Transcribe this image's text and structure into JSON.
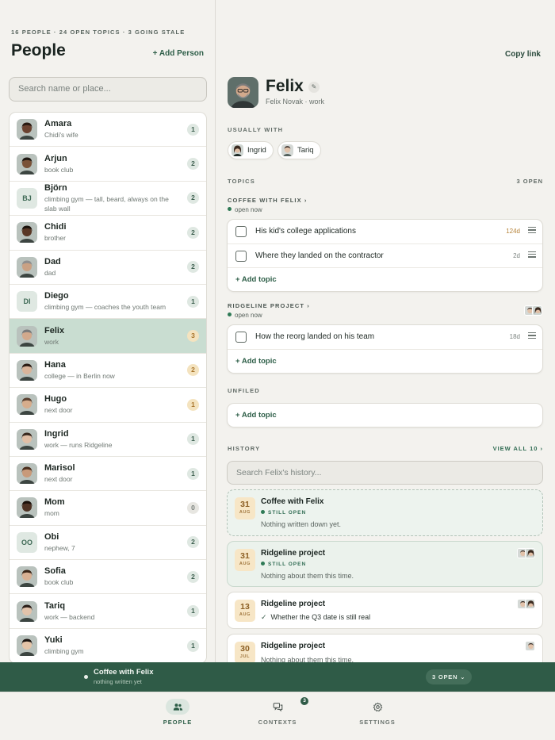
{
  "left": {
    "stats": "16 PEOPLE · 24 OPEN TOPICS · 3 GOING STALE",
    "title": "People",
    "add_person": "+ Add Person",
    "search_placeholder": "Search name or place...",
    "people": [
      {
        "name": "Amara",
        "sub": "Chidi's wife",
        "count": "1",
        "avatar": "photo",
        "skin": "#6b4230",
        "hair": "#2a1a12"
      },
      {
        "name": "Arjun",
        "sub": "book club",
        "count": "2",
        "avatar": "photo",
        "skin": "#7a5238",
        "hair": "#1e1610"
      },
      {
        "name": "Björn",
        "sub": "climbing gym — tall, beard, always on the slab wall",
        "count": "2",
        "avatar": "initials",
        "initials": "BJ"
      },
      {
        "name": "Chidi",
        "sub": "brother",
        "count": "2",
        "avatar": "photo",
        "skin": "#5a3826",
        "hair": "#1a120c"
      },
      {
        "name": "Dad",
        "sub": "dad",
        "count": "2",
        "avatar": "photo",
        "skin": "#c9a184",
        "hair": "#8f8f8f"
      },
      {
        "name": "Diego",
        "sub": "climbing gym — coaches the youth team",
        "count": "1",
        "avatar": "initials",
        "initials": "DI"
      },
      {
        "name": "Felix",
        "sub": "work",
        "count": "3",
        "avatar": "photo",
        "skin": "#d2a98c",
        "hair": "#7b7b7b",
        "selected": true,
        "warm": true
      },
      {
        "name": "Hana",
        "sub": "college — in Berlin now",
        "count": "2",
        "avatar": "photo",
        "skin": "#d9b49a",
        "hair": "#2b1c14",
        "warm": true
      },
      {
        "name": "Hugo",
        "sub": "next door",
        "count": "1",
        "avatar": "photo",
        "skin": "#d6ad8d",
        "hair": "#5b4030",
        "warm": true
      },
      {
        "name": "Ingrid",
        "sub": "work — runs Ridgeline",
        "count": "1",
        "avatar": "photo",
        "skin": "#e0bea5",
        "hair": "#3a2a20"
      },
      {
        "name": "Marisol",
        "sub": "next door",
        "count": "1",
        "avatar": "photo",
        "skin": "#c89a7a",
        "hair": "#4a2e1e"
      },
      {
        "name": "Mom",
        "sub": "mom",
        "count": "0",
        "avatar": "photo",
        "skin": "#4e3224",
        "hair": "#1a100a",
        "zero": true
      },
      {
        "name": "Obi",
        "sub": "nephew, 7",
        "count": "2",
        "avatar": "initials",
        "initials": "OO"
      },
      {
        "name": "Sofia",
        "sub": "book club",
        "count": "2",
        "avatar": "photo",
        "skin": "#d8b093",
        "hair": "#3b2618"
      },
      {
        "name": "Tariq",
        "sub": "work — backend",
        "count": "1",
        "avatar": "photo",
        "skin": "#e2c3ab",
        "hair": "#2a1e18"
      },
      {
        "name": "Yuki",
        "sub": "climbing gym",
        "count": "1",
        "avatar": "photo",
        "skin": "#e4c4a8",
        "hair": "#1c1410"
      }
    ]
  },
  "right": {
    "copy_link": "Copy link",
    "name": "Felix",
    "subtitle": "Felix Novak · work",
    "usually_with_label": "USUALLY WITH",
    "usually_with": [
      {
        "name": "Ingrid"
      },
      {
        "name": "Tariq"
      }
    ],
    "topics_label": "TOPICS",
    "topics_count": "3 OPEN",
    "contexts": [
      {
        "title": "COFFEE WITH FELIX ›",
        "status": "open now",
        "topics": [
          {
            "text": "His kid's college applications",
            "age": "124d"
          },
          {
            "text": "Where they landed on the contractor",
            "age": "2d"
          }
        ],
        "add_label": "+ Add topic"
      },
      {
        "title": "RIDGELINE PROJECT ›",
        "status": "open now",
        "topics": [
          {
            "text": "How the reorg landed on his team",
            "age": "18d"
          }
        ],
        "add_label": "+ Add topic"
      }
    ],
    "unfiled_label": "UNFILED",
    "unfiled_add": "+ Add topic",
    "history_label": "HISTORY",
    "history_view_all": "VIEW ALL 10 ›",
    "history_search_placeholder": "Search Felix's history...",
    "history": [
      {
        "day": "31",
        "month": "AUG",
        "title": "Coffee with Felix",
        "state": "STILL OPEN",
        "note": "Nothing written down yet."
      },
      {
        "day": "31",
        "month": "AUG",
        "title": "Ridgeline project",
        "state": "STILL OPEN",
        "note": "Nothing about them this time."
      },
      {
        "day": "13",
        "month": "AUG",
        "title": "Ridgeline project",
        "note": "Whether the Q3 date is still real"
      },
      {
        "day": "30",
        "month": "JUL",
        "title": "Ridgeline project",
        "note": "Nothing about them this time."
      }
    ]
  },
  "now_bar": {
    "title": "Coffee with Felix",
    "sub": "nothing written yet",
    "pill": "3 OPEN ⌄"
  },
  "tabs": [
    {
      "label": "PEOPLE",
      "icon": "people-icon"
    },
    {
      "label": "CONTEXTS",
      "icon": "chat-icon",
      "badge": "3"
    },
    {
      "label": "SETTINGS",
      "icon": "gear-icon"
    }
  ],
  "colors": {
    "accent": "#2f5b47",
    "selected_row": "#c9ddd1",
    "warm_badge": "#f4e3bf"
  }
}
